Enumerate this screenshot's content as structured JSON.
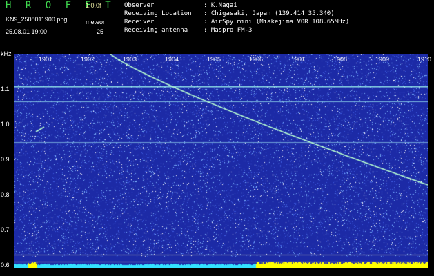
{
  "header": {
    "title": "H R O F F T",
    "version": "1.0.0f",
    "filename": "KN9_2508011900.png",
    "datetime": "25.08.01 19:00",
    "meteor_label": "meteor",
    "meteor_count": "25"
  },
  "info": [
    {
      "key": "Observer",
      "value": ": K.Nagai"
    },
    {
      "key": "Receiving Location",
      "value": ": Chigasaki, Japan (139.414 35.340)"
    },
    {
      "key": "Receiver",
      "value": ": AirSpy mini (Miakejima VOR 108.65MHz)"
    },
    {
      "key": "Receiving antenna",
      "value": ": Maspro FM-3"
    }
  ],
  "axis": {
    "unit": "kHz",
    "x_ticks": [
      "1901",
      "1902",
      "1903",
      "1904",
      "1905",
      "1906",
      "1907",
      "1908",
      "1909",
      "1910"
    ],
    "y_ticks": [
      "1.1",
      "1.0",
      "0.9",
      "0.8",
      "0.7",
      "0.6"
    ]
  },
  "colors": {
    "background": "#1c2aa6",
    "noise": "#7fb8ff",
    "signal": "#b8ffd0",
    "bar": "#33e3ff",
    "bar_high": "#ffff00"
  }
}
